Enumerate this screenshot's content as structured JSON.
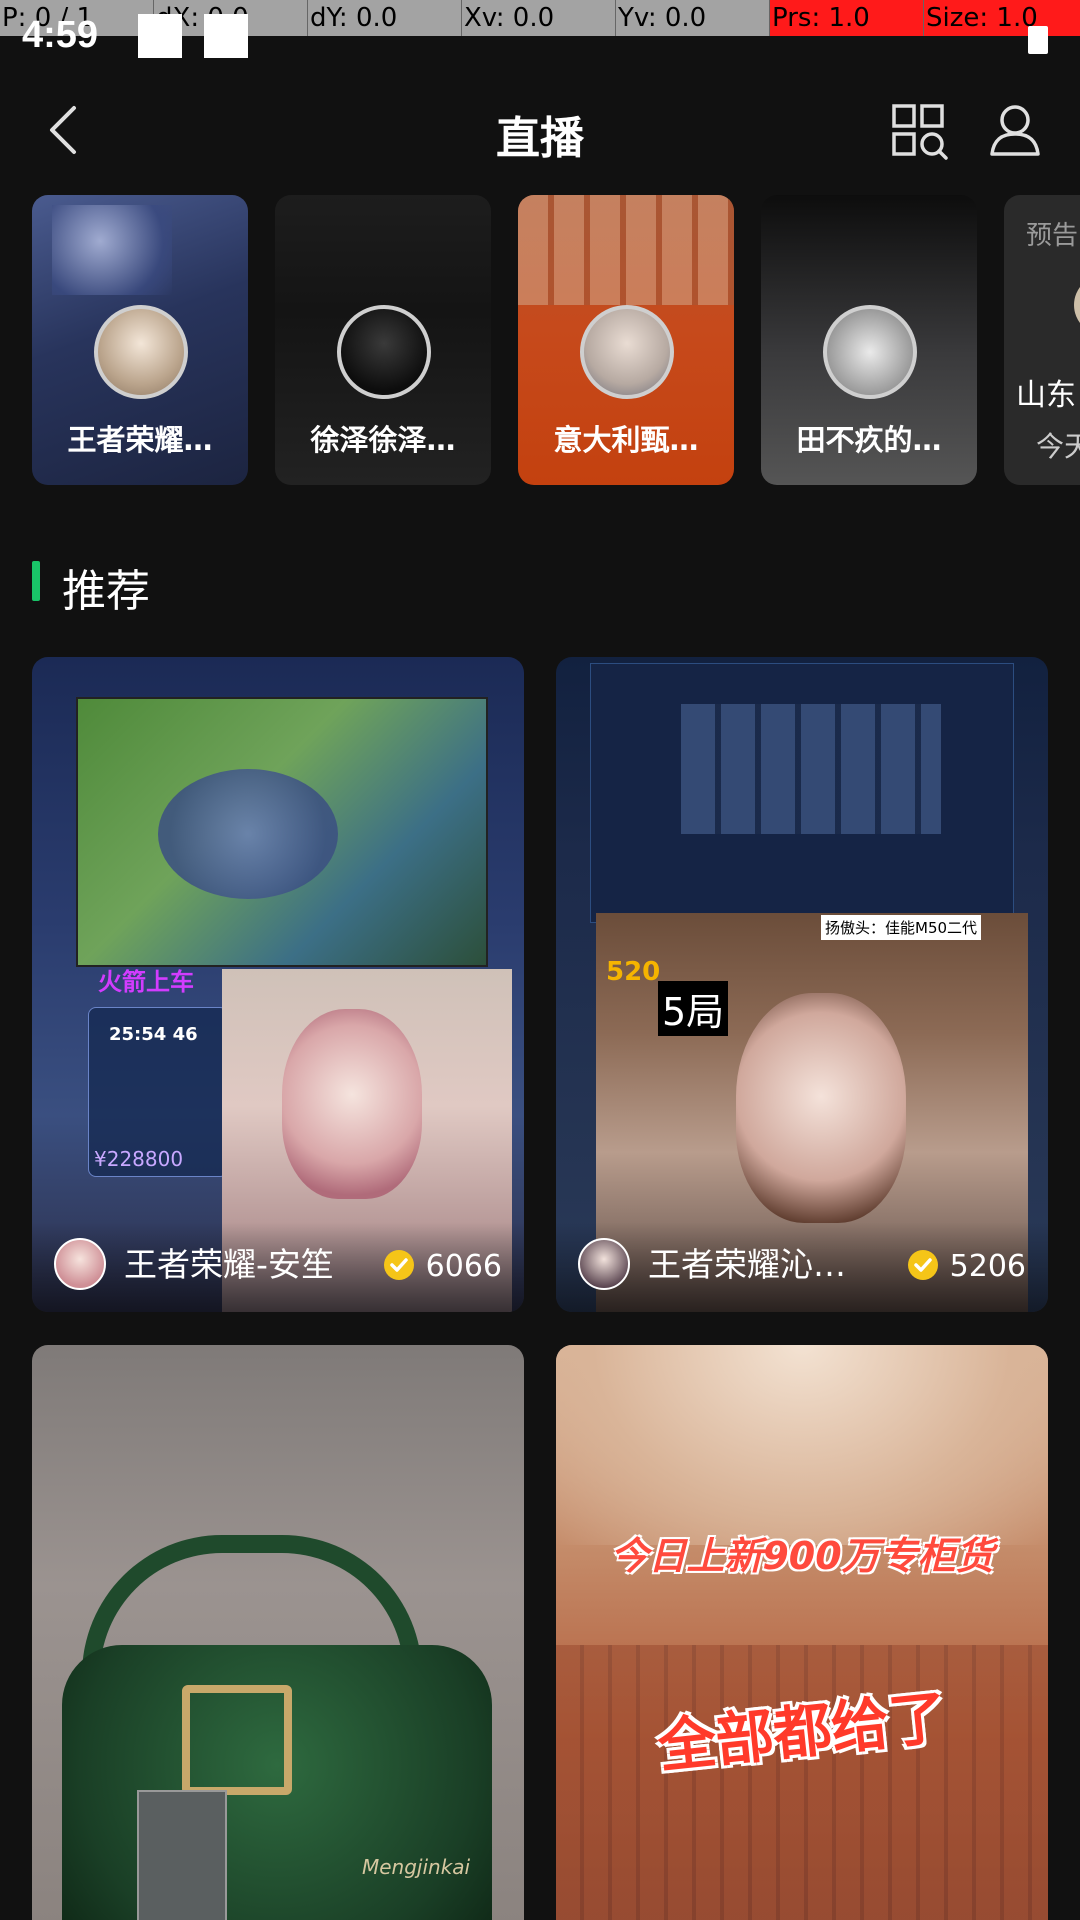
{
  "debug_bar": [
    "P: 0 / 1",
    "dX: 0.0",
    "dY: 0.0",
    "Xv: 0.0",
    "Yv: 0.0",
    "Prs: 1.0",
    "Size: 1.0"
  ],
  "status": {
    "time": "4:59"
  },
  "header": {
    "title": "直播"
  },
  "stories": [
    {
      "name": "王者荣耀…"
    },
    {
      "name": "徐泽徐泽…"
    },
    {
      "name": "意大利甄…"
    },
    {
      "name": "田不疚的…"
    }
  ],
  "preview_card": {
    "tag": "预告",
    "name": "山东",
    "date": "今天"
  },
  "section": {
    "title": "推荐"
  },
  "tiles": [
    {
      "name": "王者荣耀-安笙",
      "viewers": "6066",
      "overlay_text": [
        "火箭上车",
        "25:54 46",
        "¥228800"
      ]
    },
    {
      "name": "王者荣耀沁…",
      "viewers": "5206",
      "overlay_text": [
        "5局",
        "扬傲头：佳能M50二代",
        "520"
      ]
    },
    {
      "name": "",
      "viewers": "",
      "overlay_text": [
        "Mengjinkai"
      ]
    },
    {
      "name": "",
      "viewers": "",
      "overlay_text": [
        "今日上新900万专柜货",
        "全部都给了"
      ]
    }
  ],
  "colors": {
    "accent_green": "#19c468",
    "background": "#111111",
    "verified": "#f5c518"
  }
}
